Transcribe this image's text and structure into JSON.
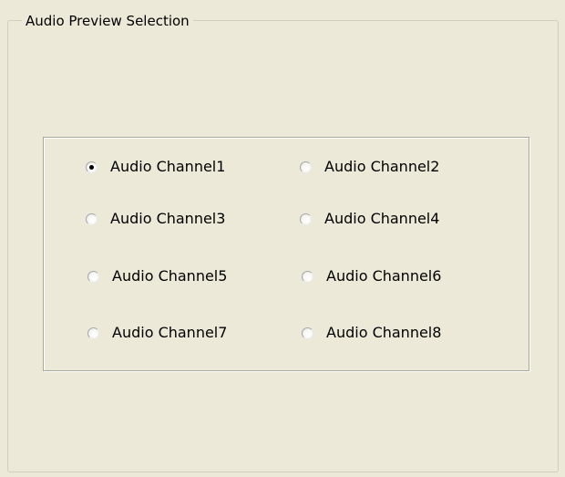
{
  "group": {
    "title": "Audio Preview Selection"
  },
  "channels": {
    "items": [
      {
        "label": "Audio Channel1",
        "checked": true
      },
      {
        "label": "Audio Channel2",
        "checked": false
      },
      {
        "label": "Audio Channel3",
        "checked": false
      },
      {
        "label": "Audio Channel4",
        "checked": false
      },
      {
        "label": "Audio Channel5",
        "checked": false
      },
      {
        "label": "Audio Channel6",
        "checked": false
      },
      {
        "label": "Audio Channel7",
        "checked": false
      },
      {
        "label": "Audio Channel8",
        "checked": false
      }
    ]
  }
}
